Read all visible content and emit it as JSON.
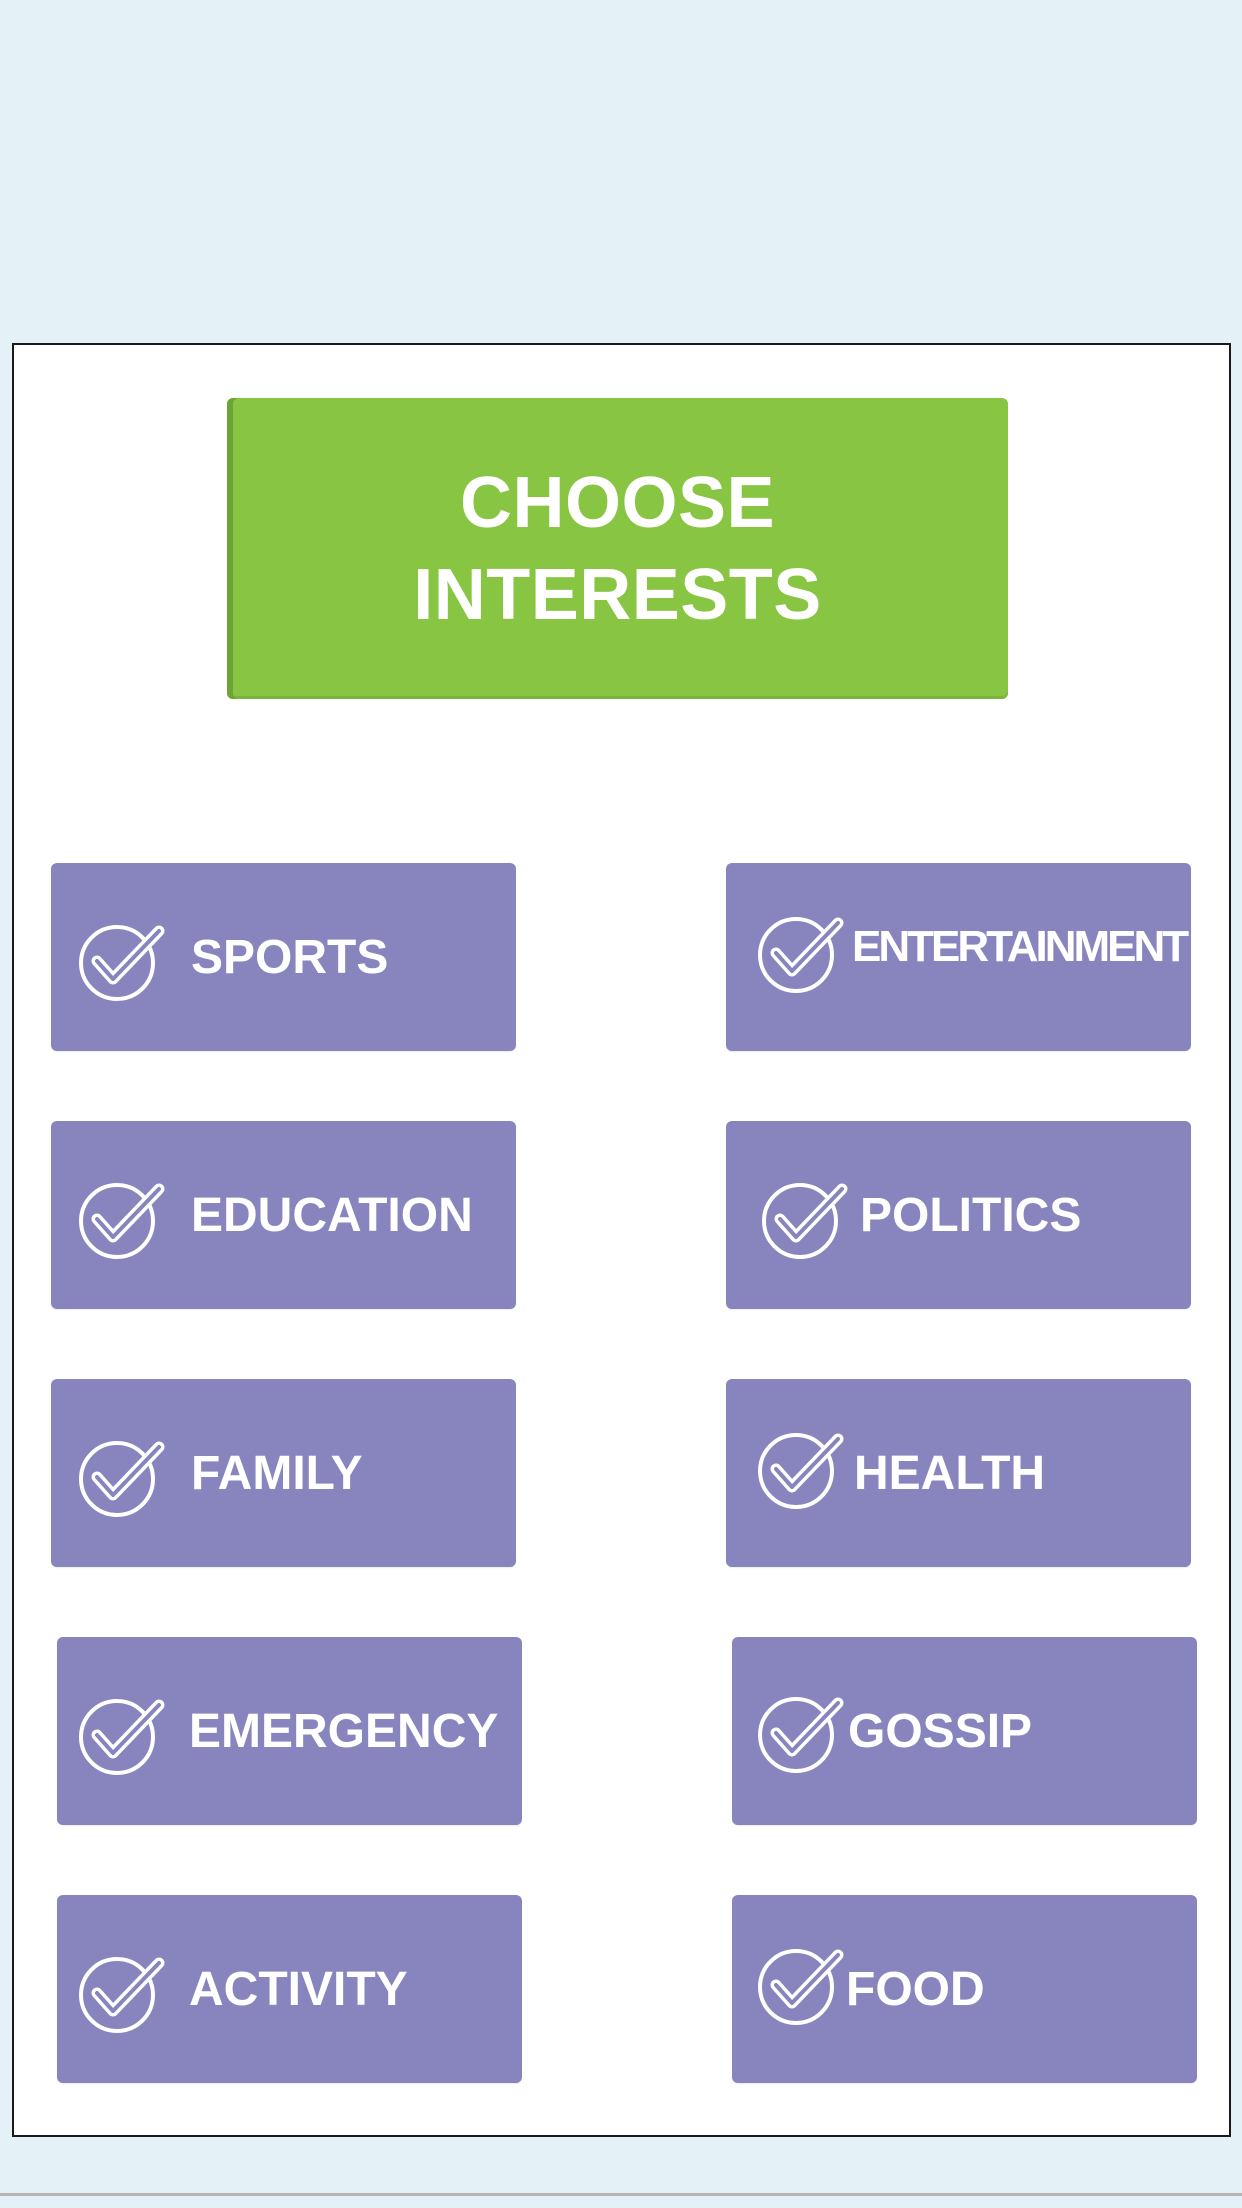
{
  "title": "CHOOSE\nINTERESTS",
  "colors": {
    "background": "#e4f2f8",
    "panel": "#ffffff",
    "title_banner": "#88c542",
    "interest_button": "#8884bd",
    "text": "#ffffff"
  },
  "interests": [
    {
      "label": "SPORTS",
      "icon": "check-circle-icon"
    },
    {
      "label": "ENTERTAINMENT",
      "icon": "check-circle-icon"
    },
    {
      "label": "EDUCATION",
      "icon": "check-circle-icon"
    },
    {
      "label": "POLITICS",
      "icon": "check-circle-icon"
    },
    {
      "label": "FAMILY",
      "icon": "check-circle-icon"
    },
    {
      "label": "HEALTH",
      "icon": "check-circle-icon"
    },
    {
      "label": "EMERGENCY",
      "icon": "check-circle-icon"
    },
    {
      "label": "GOSSIP",
      "icon": "check-circle-icon"
    },
    {
      "label": "ACTIVITY",
      "icon": "check-circle-icon"
    },
    {
      "label": "FOOD",
      "icon": "check-circle-icon"
    }
  ]
}
